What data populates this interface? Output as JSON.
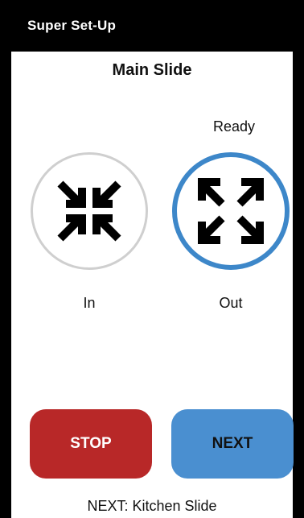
{
  "app_bar": {
    "title": "Super Set-Up"
  },
  "screen": {
    "title": "Main Slide",
    "status": "Ready"
  },
  "controls": {
    "in": {
      "label": "In",
      "icon": "arrows-collapse-icon",
      "selected": false
    },
    "out": {
      "label": "Out",
      "icon": "arrows-expand-icon",
      "selected": true
    }
  },
  "buttons": {
    "stop_label": "STOP",
    "next_label": "NEXT"
  },
  "footer": {
    "next_info": "NEXT: Kitchen Slide"
  },
  "colors": {
    "app_bar": "#000000",
    "stop": "#b82828",
    "next": "#4a8fd0",
    "selected_ring": "#3d87c9",
    "unselected_ring": "#cfcfcf"
  }
}
